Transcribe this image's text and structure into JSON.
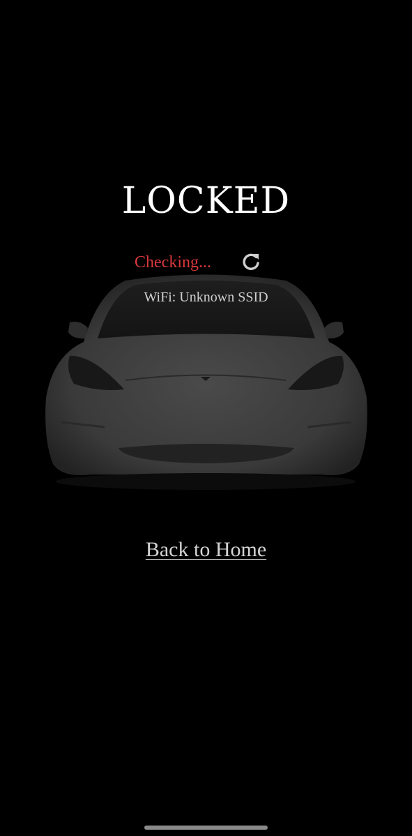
{
  "status": {
    "title": "LOCKED",
    "checking_label": "Checking...",
    "checking_color": "#d9383d",
    "refresh_icon": "refresh-icon"
  },
  "connection": {
    "wifi_label": "WiFi: Unknown SSID"
  },
  "vehicle": {
    "image": "car-front-image"
  },
  "navigation": {
    "back_home_label": "Back to Home"
  },
  "colors": {
    "background": "#000000",
    "title": "#ffffff",
    "text_muted": "#cfcfcf"
  }
}
